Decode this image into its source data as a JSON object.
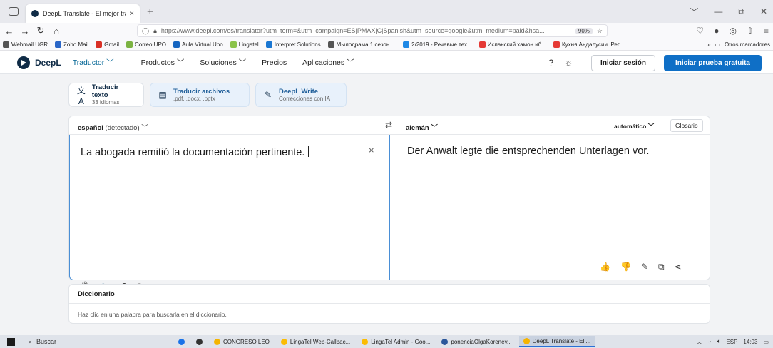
{
  "browser": {
    "tab_title": "DeepL Translate - El mejor trad",
    "tab_close": "×",
    "new_tab": "+",
    "url": "https://www.deepl.com/es/translator?utm_term=&utm_campaign=ES|PMAX|C|Spanish&utm_source=google&utm_medium=paid&hsa...",
    "zoom": "90%",
    "bookmarks": [
      {
        "label": "Webmail UGR",
        "color": "#555555"
      },
      {
        "label": "Zoho Mail",
        "color": "#2a66c7"
      },
      {
        "label": "Gmail",
        "color": "#d93025"
      },
      {
        "label": "Correo UPO",
        "color": "#7cb342"
      },
      {
        "label": "Aula Virtual Upo",
        "color": "#1565c0"
      },
      {
        "label": "Lingatel",
        "color": "#8bc34a"
      },
      {
        "label": "Interpret Solutions",
        "color": "#1976d2"
      },
      {
        "label": "Мылодрама 1 сезон ...",
        "color": "#555555"
      },
      {
        "label": "2/2019 - Речевые тех...",
        "color": "#1e88e5"
      },
      {
        "label": "Испанский хамон иб...",
        "color": "#e53935"
      },
      {
        "label": "Кухня Андалусии. Рег...",
        "color": "#e53935"
      }
    ],
    "bookmarks_more": "»",
    "other_bookmarks": "Otros marcadores"
  },
  "header": {
    "brand": "DeepL",
    "nav": [
      "Traductor ﹀",
      "Productos ﹀",
      "Soluciones ﹀",
      "Precios",
      "Aplicaciones ﹀"
    ],
    "help_icon": "?",
    "theme_icon": "☼",
    "login": "Iniciar sesión",
    "trial": "Iniciar prueba gratuita"
  },
  "modes": [
    {
      "title": "Traducir texto",
      "sub": "33 idiomas",
      "icon": "文A"
    },
    {
      "title": "Traducir archivos",
      "sub": ".pdf, .docx, .pptx",
      "icon": "▤"
    },
    {
      "title": "DeepL Write",
      "sub": "Correcciones con IA",
      "icon": "✎"
    }
  ],
  "translator": {
    "source_lang": "español",
    "source_detected": "(detectado) ﹀",
    "swap": "⇄",
    "target_lang": "alemán ﹀",
    "formality": "automático ﹀",
    "glossary": "Glosario",
    "source_text": "La abogada remitió la documentación pertinente.",
    "clear": "×",
    "target_text": "Der Anwalt legte die entsprechenden Unterlagen vor.",
    "source_tools": [
      "🎙",
      "🔈",
      "↶",
      "↷"
    ],
    "target_tools": [
      "👍",
      "👎",
      "✎",
      "⧉",
      "⋖"
    ]
  },
  "dictionary": {
    "title": "Diccionario",
    "hint": "Haz clic en una palabra para buscarla en el diccionario."
  },
  "taskbar": {
    "search": "Buscar",
    "apps": [
      {
        "label": "",
        "color": "#1a73e8",
        "active": false
      },
      {
        "label": "",
        "color": "#333333",
        "active": false
      },
      {
        "label": "CONGRESO LEO",
        "color": "#f4b400",
        "active": false
      },
      {
        "label": "LingaTel Web-Callbac...",
        "color": "#fbbc04",
        "active": false
      },
      {
        "label": "LingaTel Admin - Goo...",
        "color": "#fbbc04",
        "active": false
      },
      {
        "label": "ponenciaOlgaKorenev...",
        "color": "#2b579a",
        "active": false
      },
      {
        "label": "DeepL Translate - El ...",
        "color": "#f6b400",
        "active": true
      }
    ],
    "lang": "ESP",
    "time": "14:03"
  }
}
